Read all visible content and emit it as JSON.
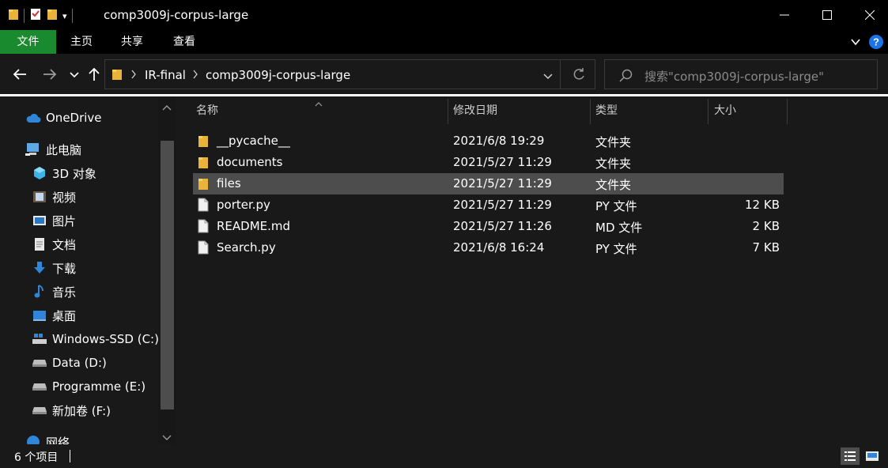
{
  "window": {
    "title": "comp3009j-corpus-large",
    "quick_access_dropdown": "▾",
    "minimize_glyph": "—",
    "maximize_glyph": "□",
    "close_glyph": "✕"
  },
  "ribbon": {
    "tabs": [
      {
        "label": "文件"
      },
      {
        "label": "主页"
      },
      {
        "label": "共享"
      },
      {
        "label": "查看"
      }
    ],
    "accent_color": "#1a8a2e",
    "help_color": "#1a73e8"
  },
  "address": {
    "breadcrumbs": [
      {
        "label": "IR-final"
      },
      {
        "label": "comp3009j-corpus-large"
      }
    ],
    "search_placeholder": "搜索\"comp3009j-corpus-large\""
  },
  "navpane": {
    "items": [
      {
        "label": "OneDrive",
        "icon": "cloud-icon"
      },
      {
        "label": "此电脑",
        "icon": "computer-icon"
      },
      {
        "label": "3D 对象",
        "icon": "cube-icon"
      },
      {
        "label": "视频",
        "icon": "video-icon"
      },
      {
        "label": "图片",
        "icon": "picture-icon"
      },
      {
        "label": "文档",
        "icon": "document-icon"
      },
      {
        "label": "下载",
        "icon": "download-icon"
      },
      {
        "label": "音乐",
        "icon": "music-icon"
      },
      {
        "label": "桌面",
        "icon": "desktop-icon"
      },
      {
        "label": "Windows-SSD (C:)",
        "icon": "windows-drive-icon"
      },
      {
        "label": "Data (D:)",
        "icon": "drive-icon"
      },
      {
        "label": "Programme (E:)",
        "icon": "drive-icon"
      },
      {
        "label": "新加卷 (F:)",
        "icon": "drive-icon"
      },
      {
        "label": "网络",
        "icon": "network-icon"
      }
    ]
  },
  "columns": {
    "name": "名称",
    "modified": "修改日期",
    "type": "类型",
    "size": "大小"
  },
  "files": [
    {
      "name": "__pycache__",
      "modified": "2021/6/8 19:29",
      "type": "文件夹",
      "size": "",
      "icon": "folder-icon"
    },
    {
      "name": "documents",
      "modified": "2021/5/27 11:29",
      "type": "文件夹",
      "size": "",
      "icon": "folder-icon"
    },
    {
      "name": "files",
      "modified": "2021/5/27 11:29",
      "type": "文件夹",
      "size": "",
      "icon": "folder-icon",
      "selected": true
    },
    {
      "name": "porter.py",
      "modified": "2021/5/27 11:29",
      "type": "PY 文件",
      "size": "12 KB",
      "icon": "file-icon"
    },
    {
      "name": "README.md",
      "modified": "2021/5/27 11:26",
      "type": "MD 文件",
      "size": "2 KB",
      "icon": "file-icon"
    },
    {
      "name": "Search.py",
      "modified": "2021/6/8 16:24",
      "type": "PY 文件",
      "size": "7 KB",
      "icon": "file-icon"
    }
  ],
  "status": {
    "item_count": "6 个项目"
  }
}
